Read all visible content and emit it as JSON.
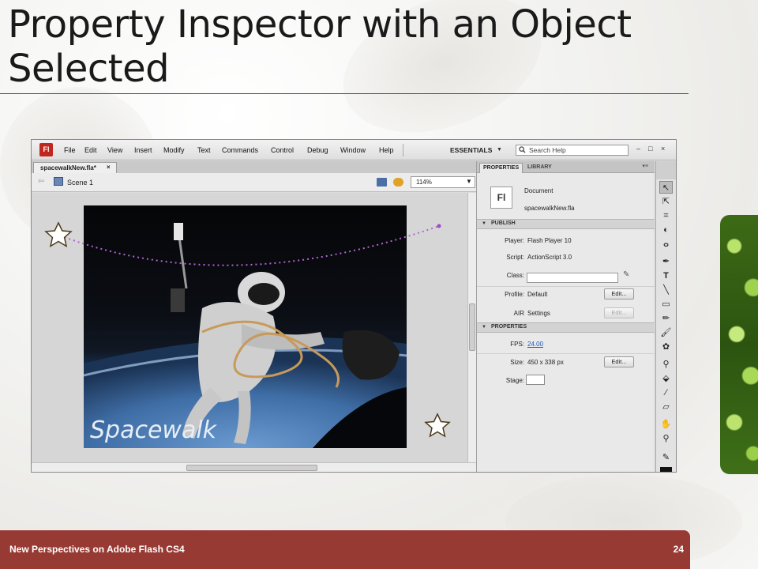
{
  "slide": {
    "title": "Property Inspector with an Object Selected",
    "footer_text": "New Perspectives on Adobe Flash CS4",
    "page_number": "24"
  },
  "app": {
    "logo": "Fl",
    "menu": [
      "File",
      "Edit",
      "View",
      "Insert",
      "Modify",
      "Text",
      "Commands",
      "Control",
      "Debug",
      "Window",
      "Help"
    ],
    "workspace": "ESSENTIALS",
    "search_placeholder": "Search Help",
    "window_controls": [
      "–",
      "□",
      "×"
    ],
    "doc_tab": "spacewalkNew.fla*",
    "doc_tab_close": "×",
    "scene": "Scene 1",
    "zoom": "114%",
    "stage_title_text": "Spacewalk"
  },
  "panel": {
    "tabs": [
      "PROPERTIES",
      "LIBRARY"
    ],
    "doc_icon": "Fl",
    "doc_type": "Document",
    "doc_name": "spacewalkNew.fla",
    "sections": {
      "publish": "PUBLISH",
      "properties": "PROPERTIES"
    },
    "publish": {
      "player_label": "Player:",
      "player_value": "Flash Player 10",
      "script_label": "Script:",
      "script_value": "ActionScript 3.0",
      "class_label": "Class:",
      "profile_label": "Profile:",
      "profile_value": "Default",
      "air_label": "AIR",
      "air_value": "Settings",
      "edit": "Edit..."
    },
    "properties": {
      "fps_label": "FPS:",
      "fps_value": "24.00",
      "size_label": "Size:",
      "size_value": "450 x 338 px",
      "stage_label": "Stage:"
    },
    "stage_color": "#ffffff"
  },
  "colors": {
    "footer_bg": "#983a34",
    "flash_red": "#c0271f",
    "link_blue": "#1f57b8"
  }
}
